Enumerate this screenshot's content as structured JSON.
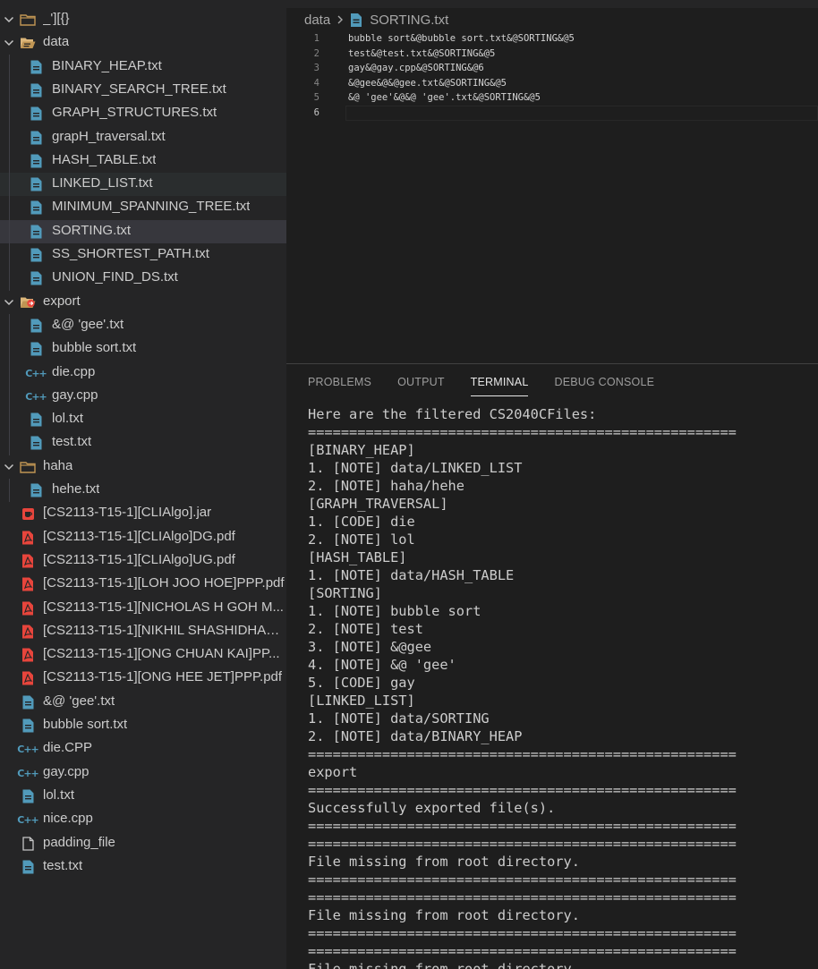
{
  "explorer": {
    "root": {
      "label": "_'][{}",
      "icon": "folder-icon"
    },
    "data_folder": {
      "label": "data",
      "icon": "folder-open-icon",
      "files": [
        {
          "label": "BINARY_HEAP.txt",
          "icon": "file-text-icon"
        },
        {
          "label": "BINARY_SEARCH_TREE.txt",
          "icon": "file-text-icon"
        },
        {
          "label": "GRAPH_STRUCTURES.txt",
          "icon": "file-text-icon"
        },
        {
          "label": "grapH_traversal.txt",
          "icon": "file-text-icon"
        },
        {
          "label": "HASH_TABLE.txt",
          "icon": "file-text-icon"
        },
        {
          "label": "LINKED_LIST.txt",
          "icon": "file-text-icon"
        },
        {
          "label": "MINIMUM_SPANNING_TREE.txt",
          "icon": "file-text-icon"
        },
        {
          "label": "SORTING.txt",
          "icon": "file-text-icon"
        },
        {
          "label": "SS_SHORTEST_PATH.txt",
          "icon": "file-text-icon"
        },
        {
          "label": "UNION_FIND_DS.txt",
          "icon": "file-text-icon"
        }
      ]
    },
    "export_folder": {
      "label": "export",
      "icon": "folder-export-icon",
      "files": [
        {
          "label": "&@ 'gee'.txt",
          "icon": "file-text-icon"
        },
        {
          "label": "bubble sort.txt",
          "icon": "file-text-icon"
        },
        {
          "label": "die.cpp",
          "icon": "cpp-file-icon"
        },
        {
          "label": "gay.cpp",
          "icon": "cpp-file-icon"
        },
        {
          "label": "lol.txt",
          "icon": "file-text-icon"
        },
        {
          "label": "test.txt",
          "icon": "file-text-icon"
        }
      ]
    },
    "haha_folder": {
      "label": "haha",
      "icon": "folder-icon",
      "files": [
        {
          "label": "hehe.txt",
          "icon": "file-text-icon"
        }
      ]
    },
    "root_files": [
      {
        "label": "[CS2113-T15-1][CLIAlgo].jar",
        "icon": "jar-file-icon"
      },
      {
        "label": "[CS2113-T15-1][CLIAlgo]DG.pdf",
        "icon": "pdf-file-icon"
      },
      {
        "label": "[CS2113-T15-1][CLIAlgo]UG.pdf",
        "icon": "pdf-file-icon"
      },
      {
        "label": "[CS2113-T15-1][LOH JOO HOE]PPP.pdf",
        "icon": "pdf-file-icon"
      },
      {
        "label": "[CS2113-T15-1][NICHOLAS H GOH M...",
        "icon": "pdf-file-icon"
      },
      {
        "label": "[CS2113-T15-1][NIKHIL SHASHIDHAR...",
        "icon": "pdf-file-icon"
      },
      {
        "label": "[CS2113-T15-1][ONG CHUAN KAI]PP...",
        "icon": "pdf-file-icon"
      },
      {
        "label": "[CS2113-T15-1][ONG HEE JET]PPP.pdf",
        "icon": "pdf-file-icon"
      },
      {
        "label": "&@ 'gee'.txt",
        "icon": "file-text-icon"
      },
      {
        "label": "bubble sort.txt",
        "icon": "file-text-icon"
      },
      {
        "label": "die.CPP",
        "icon": "cpp-file-icon"
      },
      {
        "label": "gay.cpp",
        "icon": "cpp-file-icon"
      },
      {
        "label": "lol.txt",
        "icon": "file-text-icon"
      },
      {
        "label": "nice.cpp",
        "icon": "cpp-file-icon"
      },
      {
        "label": "padding_file",
        "icon": "file-plain-icon"
      },
      {
        "label": "test.txt",
        "icon": "file-text-icon"
      }
    ],
    "selected_file": "SORTING.txt",
    "hovered_file": "LINKED_LIST.txt"
  },
  "editor": {
    "breadcrumb": {
      "folder": "data",
      "file": "SORTING.txt"
    },
    "lines": [
      {
        "number": "1",
        "text": "bubble sort&@bubble sort.txt&@SORTING&@5"
      },
      {
        "number": "2",
        "text": "test&@test.txt&@SORTING&@5"
      },
      {
        "number": "3",
        "text": "gay&@gay.cpp&@SORTING&@6"
      },
      {
        "number": "4",
        "text": "&@gee&@&@gee.txt&@SORTING&@5"
      },
      {
        "number": "5",
        "text": "&@ 'gee'&@&@ 'gee'.txt&@SORTING&@5"
      },
      {
        "number": "6",
        "text": ""
      }
    ],
    "active_line": "6"
  },
  "panel": {
    "tabs": [
      {
        "label": "PROBLEMS",
        "active": false
      },
      {
        "label": "OUTPUT",
        "active": false
      },
      {
        "label": "TERMINAL",
        "active": true
      },
      {
        "label": "DEBUG CONSOLE",
        "active": false
      }
    ],
    "terminal_lines": [
      "Here are the filtered CS2040CFiles:",
      "====================================================",
      "[BINARY_HEAP]",
      "1. [NOTE] data/LINKED_LIST",
      "2. [NOTE] haha/hehe",
      "[GRAPH_TRAVERSAL]",
      "1. [CODE] die",
      "2. [NOTE] lol",
      "[HASH_TABLE]",
      "1. [NOTE] data/HASH_TABLE",
      "[SORTING]",
      "1. [NOTE] bubble sort",
      "2. [NOTE] test",
      "3. [NOTE] &@gee",
      "4. [NOTE] &@ 'gee'",
      "5. [CODE] gay",
      "[LINKED_LIST]",
      "1. [NOTE] data/SORTING",
      "2. [NOTE] data/BINARY_HEAP",
      "====================================================",
      "export",
      "====================================================",
      "Successfully exported file(s).",
      "====================================================",
      "====================================================",
      "File missing from root directory.",
      "====================================================",
      "====================================================",
      "File missing from root directory.",
      "====================================================",
      "====================================================",
      "File missing from root directory."
    ]
  },
  "colors": {
    "sidebar_bg": "#252526",
    "editor_bg": "#1e1e1e",
    "selected_row": "#37373d",
    "text_file_icon": "#519aba",
    "pdf_icon": "#e8453c",
    "jar_icon": "#e8453c",
    "folder_icon": "#c09553",
    "export_folder_badge": "#e8453c"
  }
}
